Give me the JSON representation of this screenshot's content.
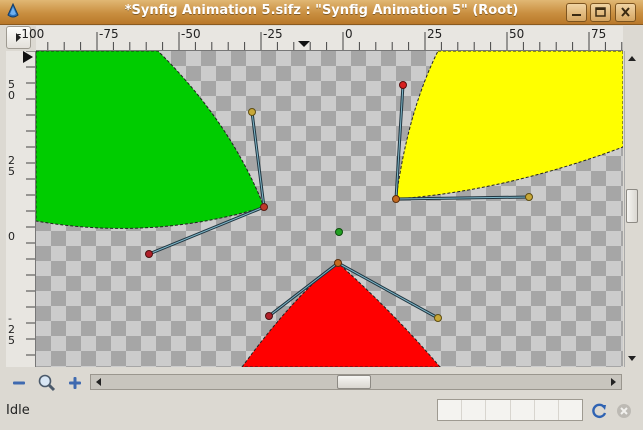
{
  "window": {
    "title": "*Synfig Animation 5.sifz : \"Synfig Animation 5\" (Root)"
  },
  "window_buttons": [
    "minimize",
    "maximize",
    "close"
  ],
  "ruler": {
    "h_labels": [
      "-100",
      "-75",
      "-50",
      "-25",
      "0",
      "25",
      "50",
      "75"
    ],
    "v_labels": [
      "5\n0",
      "2\n5",
      "0",
      "-\n2\n5"
    ]
  },
  "canvas": {
    "colors": {
      "green": "#00cc00",
      "yellow": "#ffff00",
      "red": "#ff0000",
      "handle_line": "#7fb6c8"
    }
  },
  "status": {
    "text": "Idle"
  },
  "icons": {
    "zoom_out": "minus-icon",
    "zoom_fit": "magnifier-icon",
    "zoom_in": "plus-icon",
    "refresh": "refresh-icon",
    "stop": "stop-icon"
  }
}
